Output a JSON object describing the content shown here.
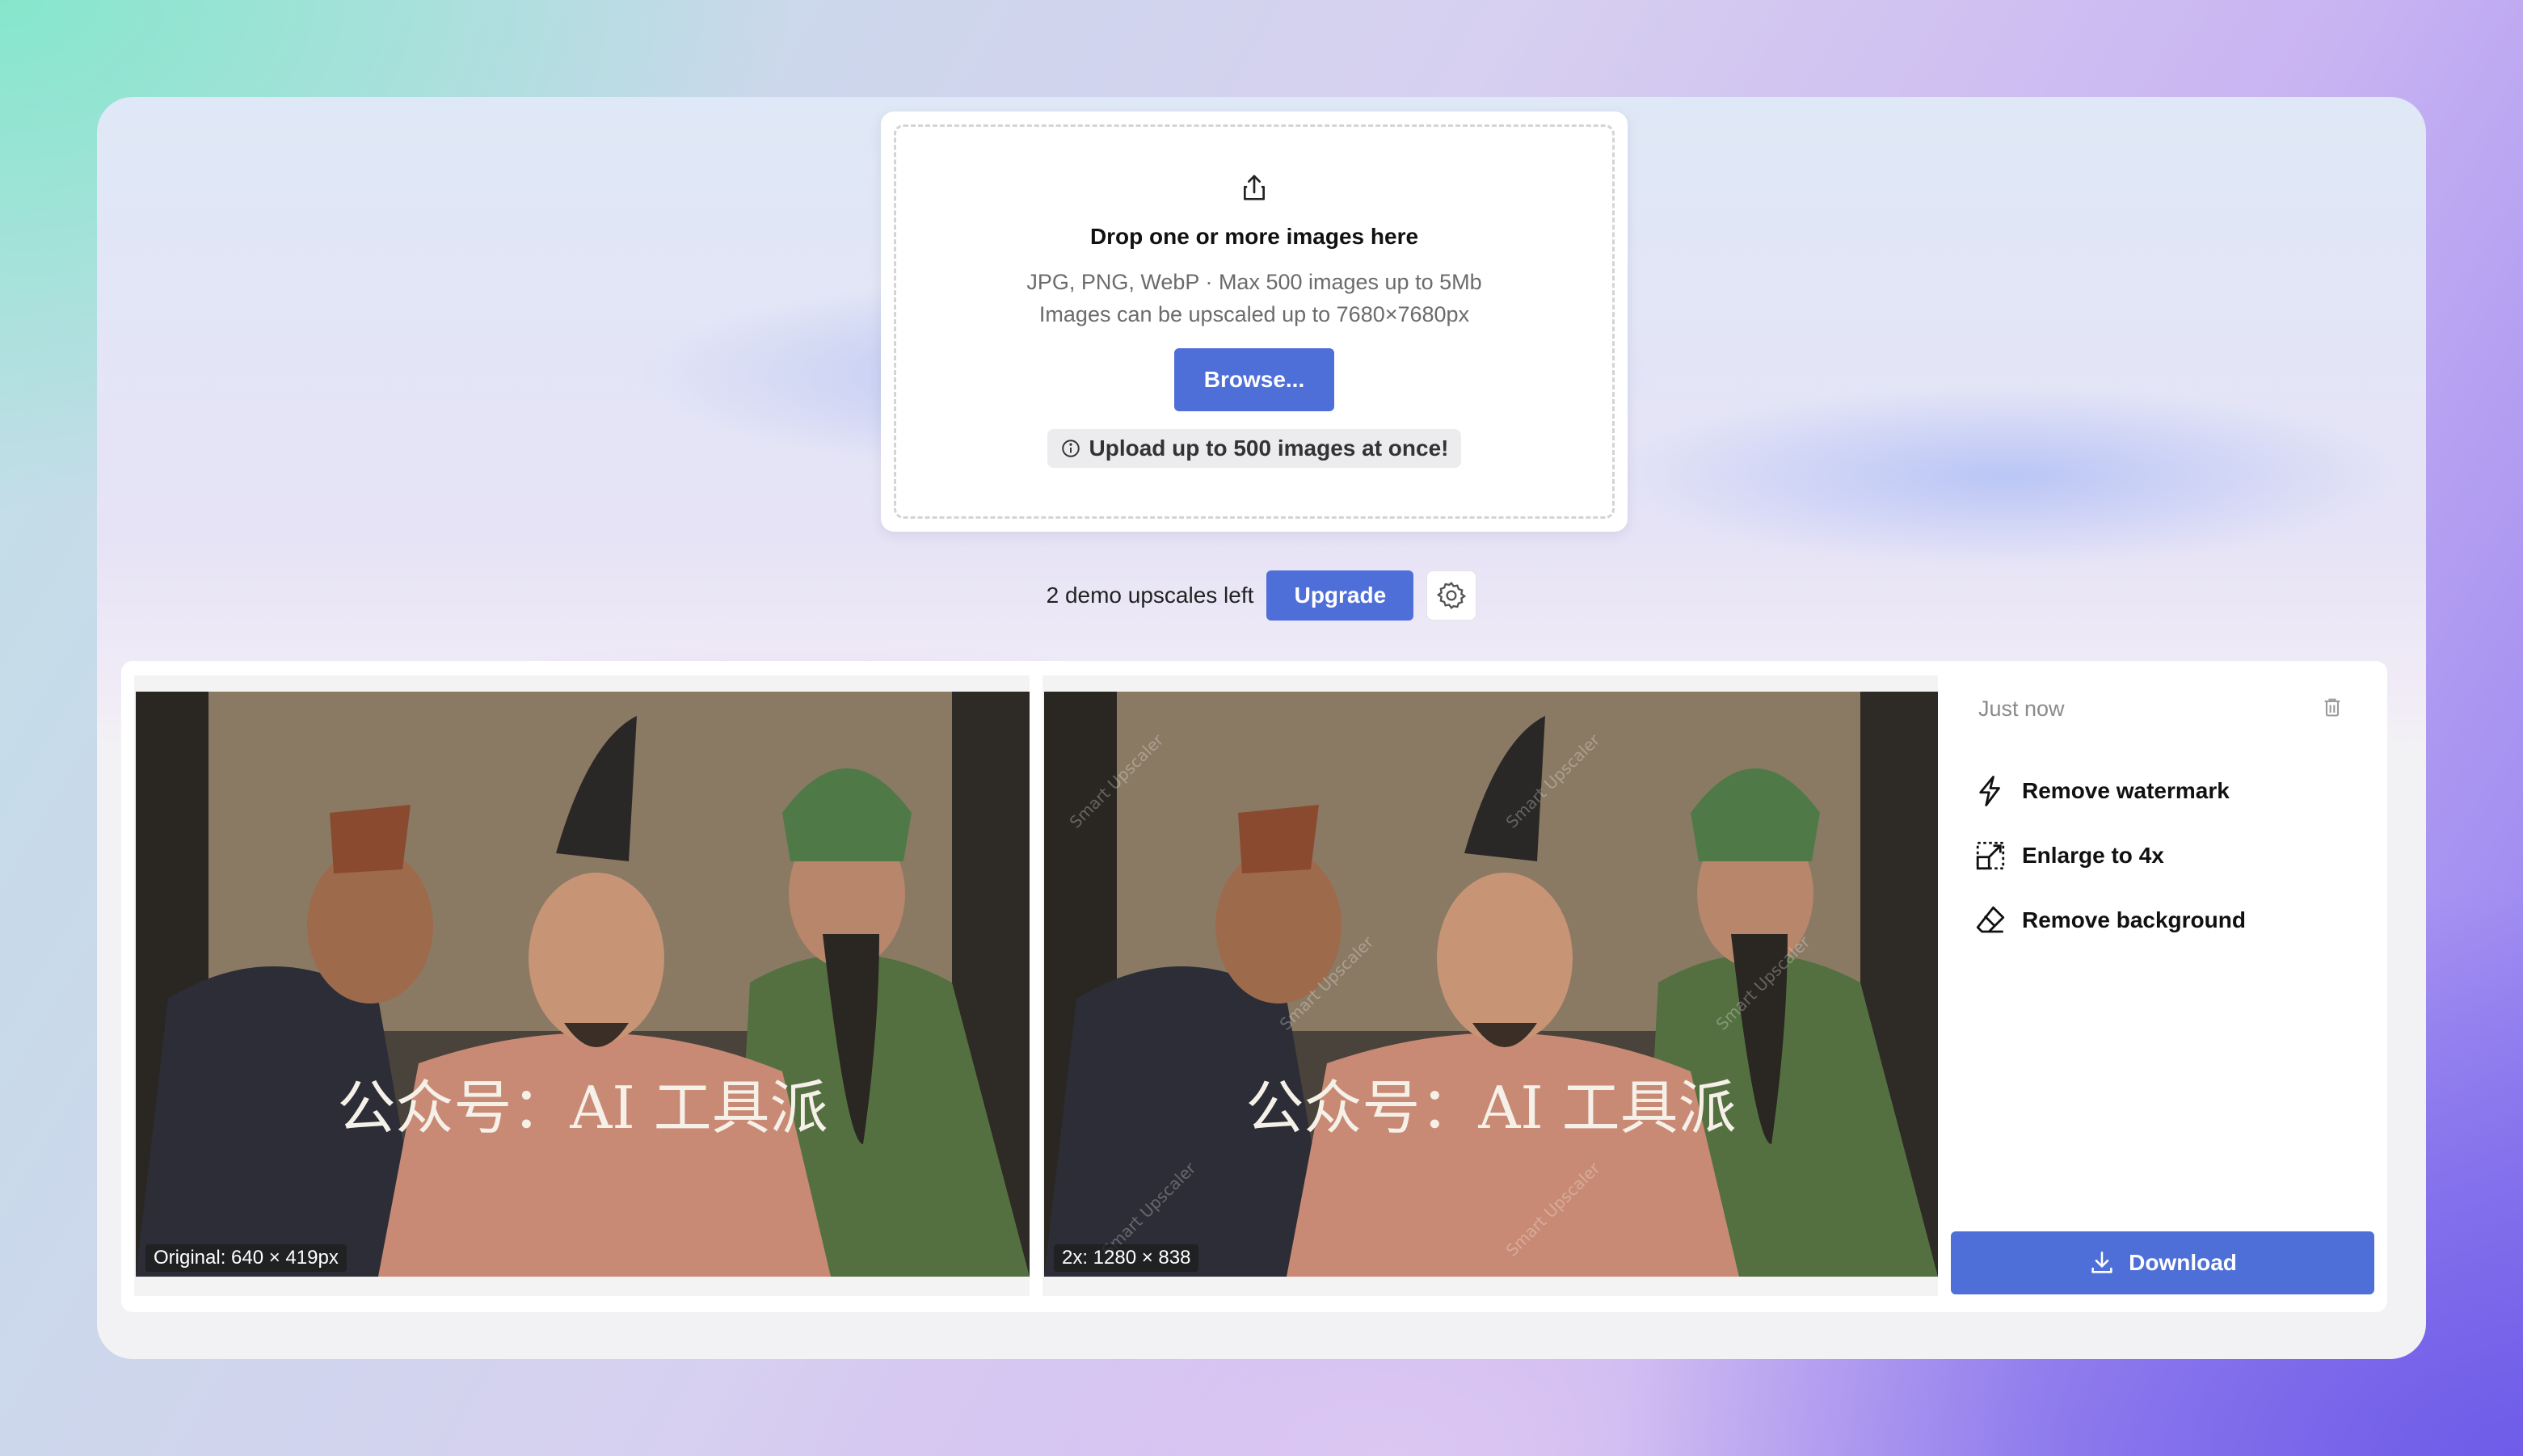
{
  "upload": {
    "title": "Drop one or more images here",
    "formats": "JPG, PNG, WebP · Max 500 images up to 5Mb",
    "limit": "Images can be upscaled up to 7680×7680px",
    "browse_label": "Browse...",
    "hint": "Upload up to 500 images at once!",
    "icon": "upload-icon"
  },
  "demo": {
    "remaining_text": "2 demo upscales left",
    "upgrade_label": "Upgrade",
    "settings_icon": "gear-icon"
  },
  "result": {
    "original_label": "Original: 640 × 419px",
    "upscaled_label": "2x: 1280 × 838",
    "image_caption": "公众号：AI 工具派",
    "watermark_text": "Smart Upscaler",
    "timestamp": "Just now",
    "actions": [
      {
        "label": "Remove watermark",
        "icon": "lightning-icon"
      },
      {
        "label": "Enlarge to 4x",
        "icon": "enlarge-icon"
      },
      {
        "label": "Remove background",
        "icon": "eraser-icon"
      }
    ],
    "download_label": "Download"
  },
  "colors": {
    "accent": "#4f6fd8",
    "card": "#ffffff",
    "panel": "#f2f2f4"
  }
}
